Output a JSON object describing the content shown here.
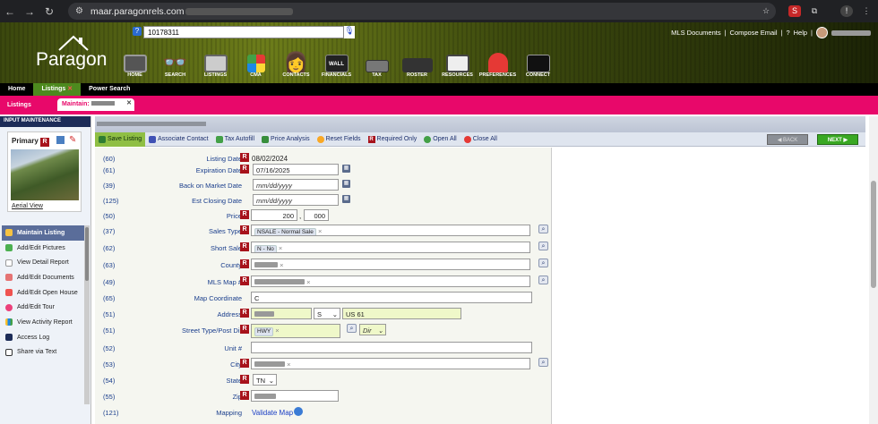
{
  "browser": {
    "url": "maar.paragonrels.com"
  },
  "header": {
    "logo": "Paragon",
    "search_value": "10178311",
    "links": [
      "MLS Documents",
      "Compose Email",
      "Help"
    ],
    "nav": [
      {
        "label": "HOME",
        "icon": "tv-icon"
      },
      {
        "label": "SEARCH",
        "icon": "glasses-icon"
      },
      {
        "label": "LISTINGS",
        "icon": "boombox-icon"
      },
      {
        "label": "CMA",
        "icon": "rubiks-cube-icon"
      },
      {
        "label": "CONTACTS",
        "icon": "contacts-icon"
      },
      {
        "label": "FINANCIALS",
        "icon": "wall-street-icon"
      },
      {
        "label": "TAX",
        "icon": "cassette-icon"
      },
      {
        "label": "ROSTER",
        "icon": "van-icon"
      },
      {
        "label": "RESOURCES",
        "icon": "camera-icon"
      },
      {
        "label": "PREFERENCES",
        "icon": "pacman-ghost-icon"
      },
      {
        "label": "CONNECT",
        "icon": "connect-icon"
      }
    ]
  },
  "tabs": {
    "home": "Home",
    "listings": "Listings",
    "power_search": "Power Search"
  },
  "subtabs": {
    "listings": "Listings",
    "maintain": "Maintain:"
  },
  "sidebar": {
    "header": "INPUT MAINTENANCE",
    "primary": "Primary",
    "aerial": "Aerial View",
    "items": [
      "Maintain Listing",
      "Add/Edit Pictures",
      "View Detail Report",
      "Add/Edit Documents",
      "Add/Edit Open House",
      "Add/Edit Tour",
      "View Activity Report",
      "Access Log",
      "Share via Text"
    ]
  },
  "toolbar": {
    "save": "Save Listing",
    "associate": "Associate Contact",
    "autofill": "Tax Autofill",
    "price_analysis": "Price Analysis",
    "reset": "Reset Fields",
    "required": "Required Only",
    "open_all": "Open All",
    "close_all": "Close All",
    "back": "BACK",
    "next": "NEXT"
  },
  "form": {
    "listing_date": {
      "num": "(60)",
      "label": "Listing Date",
      "value": "08/02/2024"
    },
    "expiration_date": {
      "num": "(61)",
      "label": "Expiration Date",
      "value": "07/16/2025"
    },
    "back_on_market": {
      "num": "(39)",
      "label": "Back on Market Date",
      "placeholder": "mm/dd/yyyy"
    },
    "est_closing": {
      "num": "(125)",
      "label": "Est Closing Date",
      "placeholder": "mm/dd/yyyy"
    },
    "price": {
      "num": "(50)",
      "label": "Price",
      "value": "200",
      "value2": "000",
      "sep": ","
    },
    "sales_type": {
      "num": "(37)",
      "label": "Sales Type",
      "value": "NSALE - Normal Sale"
    },
    "short_sale": {
      "num": "(62)",
      "label": "Short Sale",
      "value": "N - No"
    },
    "county": {
      "num": "(63)",
      "label": "County"
    },
    "mls_map": {
      "num": "(49)",
      "label": "MLS Map #"
    },
    "map_coord": {
      "num": "(65)",
      "label": "Map Coordinate",
      "value": "C"
    },
    "address": {
      "num": "(51)",
      "label": "Address",
      "direction": "S",
      "street": "US 61"
    },
    "street_type": {
      "num": "(51)",
      "label": "Street Type/Post Dir",
      "value": "HWY",
      "dir_placeholder": "Dir"
    },
    "unit": {
      "num": "(52)",
      "label": "Unit #"
    },
    "city": {
      "num": "(53)",
      "label": "City"
    },
    "state": {
      "num": "(54)",
      "label": "State",
      "value": "TN"
    },
    "zip": {
      "num": "(55)",
      "label": "Zip"
    },
    "mapping": {
      "num": "(121)",
      "label": "Mapping",
      "link": "Validate Map"
    }
  }
}
